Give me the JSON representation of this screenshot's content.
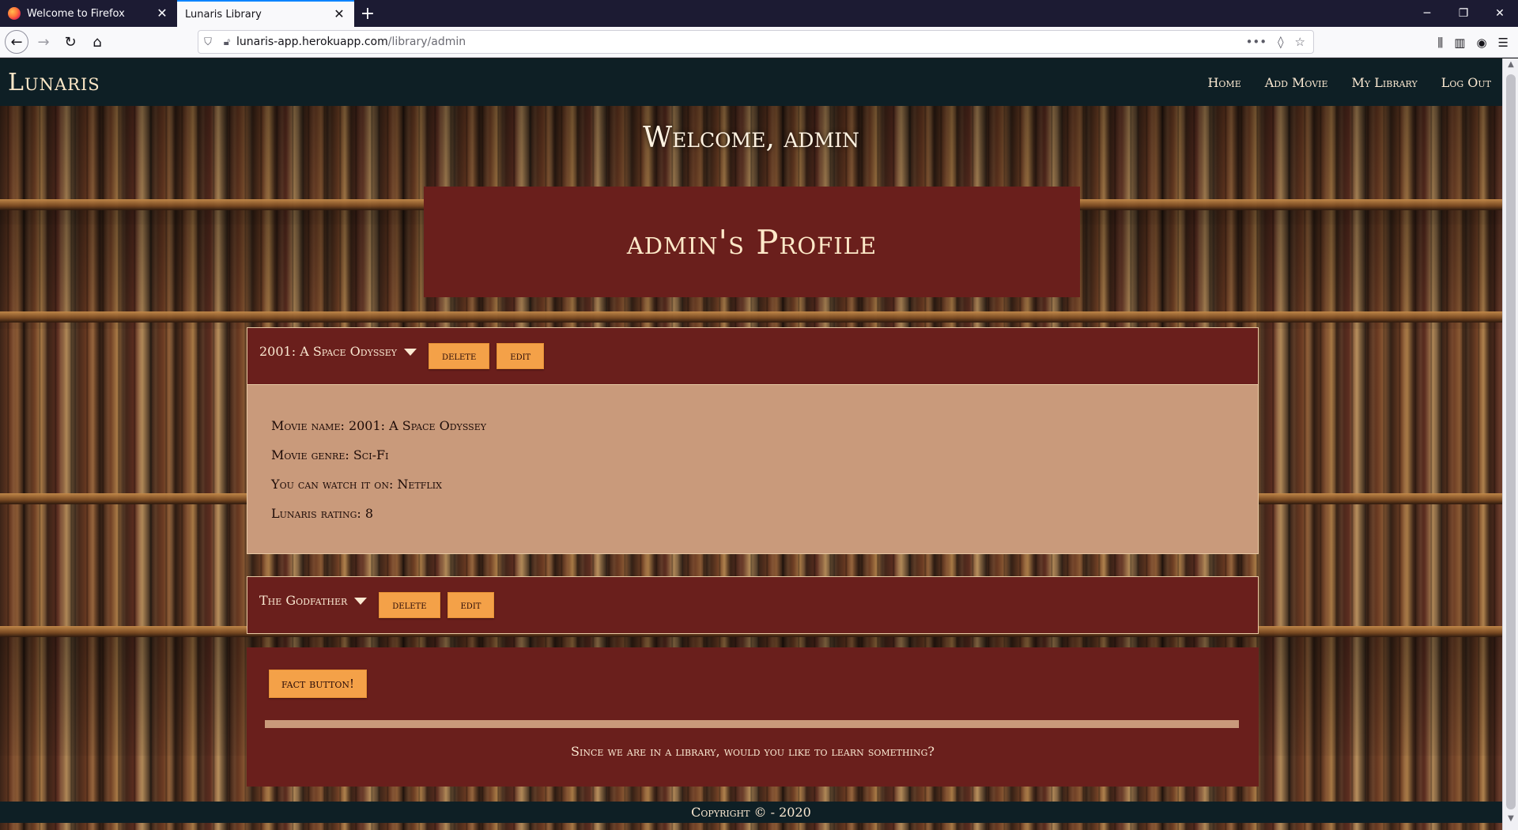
{
  "browser": {
    "tabs": [
      {
        "label": "Welcome to Firefox",
        "active": false
      },
      {
        "label": "Lunaris Library",
        "active": true
      }
    ],
    "new_tab_icon": "+",
    "url_host": "lunaris-app.herokuapp.com",
    "url_path": "/library/admin"
  },
  "site": {
    "brand": "Lunaris",
    "nav": [
      "Home",
      "Add Movie",
      "My Library",
      "Log Out"
    ]
  },
  "welcome": "Welcome, admin",
  "profile_title": "admin's Profile",
  "movies": [
    {
      "title": "2001: A Space Odyssey",
      "delete_label": "delete",
      "edit_label": "edit",
      "expanded": true,
      "details": [
        "Movie name: 2001: A Space Odyssey",
        "Movie genre: Sci-Fi",
        "You can watch it on: Netflix",
        "Lunaris rating: 8"
      ]
    },
    {
      "title": "The Godfather",
      "delete_label": "delete",
      "edit_label": "edit",
      "expanded": false
    }
  ],
  "fact": {
    "button_label": "fact button!",
    "prompt": "Since we are in a library, would you like to learn something?"
  },
  "footer": "Copyright © - 2020",
  "colors": {
    "header_bg": "#0e1f25",
    "panel_bg": "#6a1f1c",
    "panel_body": "#c99a7b",
    "button": "#f4a148",
    "text_light": "#fbe9d2"
  }
}
